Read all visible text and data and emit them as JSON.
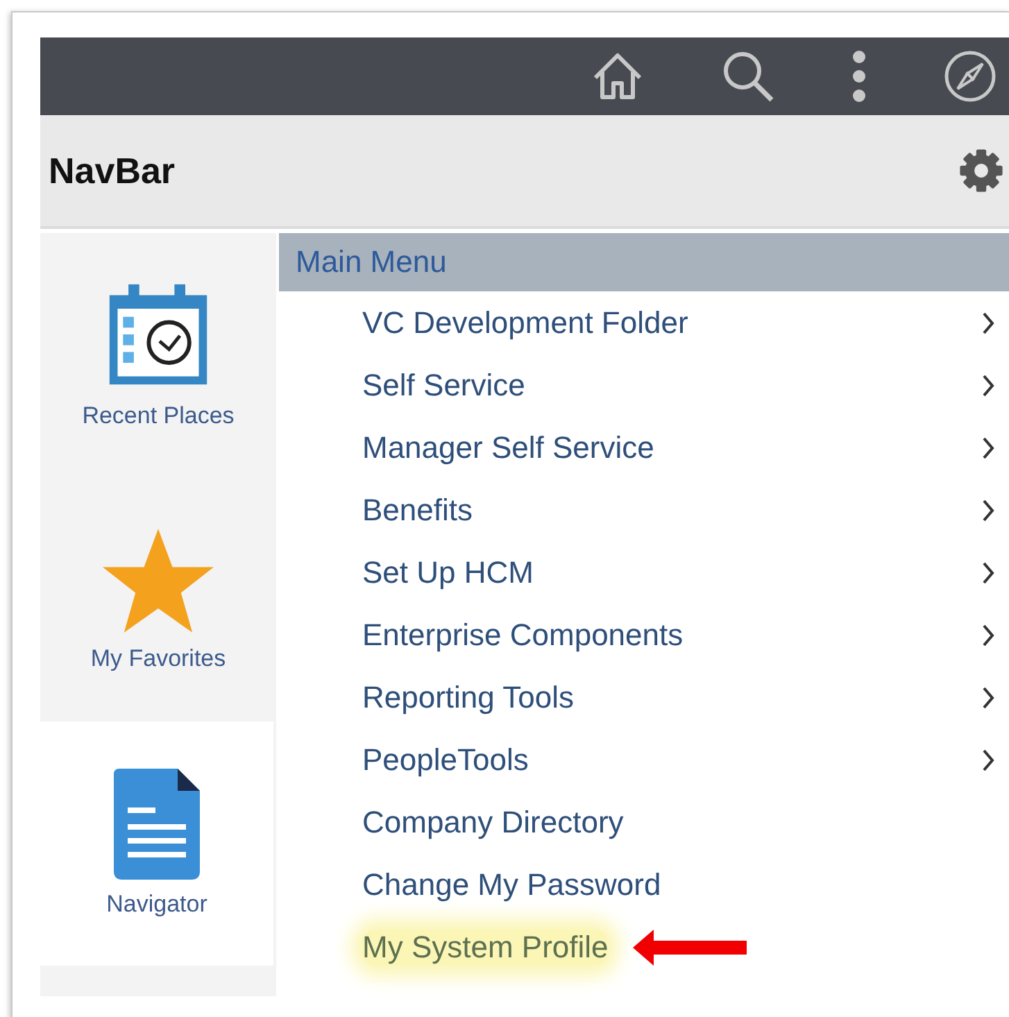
{
  "header": {
    "title": "NavBar"
  },
  "sidebar": {
    "items": [
      {
        "label": "Recent Places",
        "selected": false
      },
      {
        "label": "My Favorites",
        "selected": false
      },
      {
        "label": "Navigator",
        "selected": true
      }
    ]
  },
  "menu": {
    "title": "Main Menu",
    "items": [
      {
        "label": "VC Development Folder",
        "expandable": true,
        "highlighted": false
      },
      {
        "label": "Self Service",
        "expandable": true,
        "highlighted": false
      },
      {
        "label": "Manager Self Service",
        "expandable": true,
        "highlighted": false
      },
      {
        "label": "Benefits",
        "expandable": true,
        "highlighted": false
      },
      {
        "label": "Set Up HCM",
        "expandable": true,
        "highlighted": false
      },
      {
        "label": "Enterprise Components",
        "expandable": true,
        "highlighted": false
      },
      {
        "label": "Reporting Tools",
        "expandable": true,
        "highlighted": false
      },
      {
        "label": "PeopleTools",
        "expandable": true,
        "highlighted": false
      },
      {
        "label": "Company Directory",
        "expandable": false,
        "highlighted": false
      },
      {
        "label": "Change My Password",
        "expandable": false,
        "highlighted": false
      },
      {
        "label": "My System Profile",
        "expandable": false,
        "highlighted": true
      }
    ]
  }
}
